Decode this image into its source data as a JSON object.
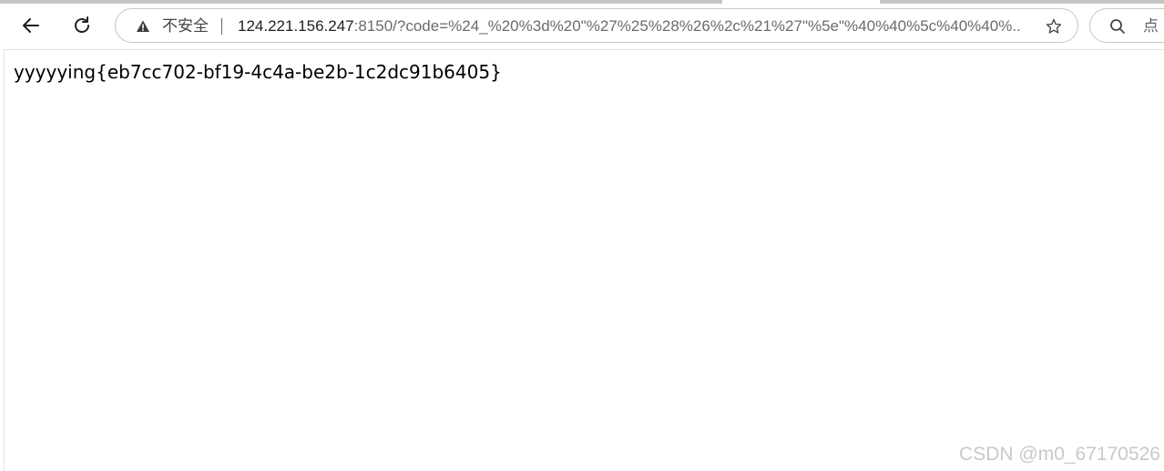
{
  "toolbar": {
    "back_icon": "arrow-left-icon",
    "reload_icon": "reload-icon"
  },
  "omnibox": {
    "security_icon": "warning-triangle-icon",
    "security_label": "不安全",
    "url_host": "124.221.156.247",
    "url_rest": ":8150/?code=%24_%20%3d%20\"%27%25%28%26%2c%21%27\"%5e\"%40%40%5c%40%40%...",
    "bookmark_icon": "star-icon"
  },
  "search": {
    "icon": "search-icon",
    "label": "点"
  },
  "page": {
    "body_text": "yyyyying{eb7cc702-bf19-4c4a-be2b-1c2dc91b6405}"
  },
  "watermark": {
    "text": "CSDN @m0_67170526"
  },
  "colors": {
    "page_bg": "#ffffff",
    "omnibox_border": "#c7c7c7",
    "url_host": "#1f1f1f",
    "url_rest": "#6b6b6b",
    "watermark": "#c9c9c9"
  }
}
